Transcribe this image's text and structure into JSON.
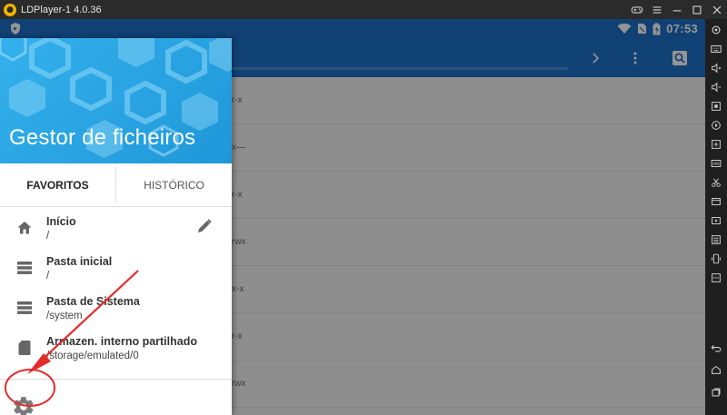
{
  "window": {
    "title": "LDPlayer-1 4.0.36",
    "logo_icon": "ldplayer-logo-icon",
    "controls": [
      "gamepad-icon",
      "menu-icon",
      "minimize-icon",
      "maximize-icon",
      "close-icon"
    ]
  },
  "statusbar": {
    "time": "07:53",
    "icons": [
      "shield-icon",
      "wifi-icon",
      "sim-icon",
      "battery-icon"
    ],
    "color": "#1c6fc9"
  },
  "appbar": {
    "color": "#1d73cc",
    "icons": [
      "chevron-right-icon",
      "more-vert-icon",
      "search-icon"
    ]
  },
  "background_rows": [
    {
      "perm": "r-x"
    },
    {
      "perm": "x—"
    },
    {
      "perm": "r-x"
    },
    {
      "perm": "rwx"
    },
    {
      "perm": "x-x"
    },
    {
      "perm": "r-x"
    },
    {
      "perm": "rwx"
    }
  ],
  "drawer": {
    "title": "Gestor de ficheiros",
    "header_color": "#2aa7e5",
    "tabs": [
      {
        "label": "FAVORITOS",
        "active": true
      },
      {
        "label": "HISTÓRICO",
        "active": false
      }
    ],
    "items": [
      {
        "icon": "home-icon",
        "label": "Início",
        "path": "/"
      },
      {
        "icon": "storage-icon",
        "label": "Pasta inicial",
        "path": "/"
      },
      {
        "icon": "storage-icon",
        "label": "Pasta de Sistema",
        "path": "/system"
      },
      {
        "icon": "sd-card-icon",
        "label": "Armazen. interno partilhado",
        "path": "/storage/emulated/0"
      }
    ],
    "edit_icon": "pencil-icon",
    "settings_icon": "gear-icon"
  },
  "annotation": {
    "color": "#e32b2b"
  }
}
